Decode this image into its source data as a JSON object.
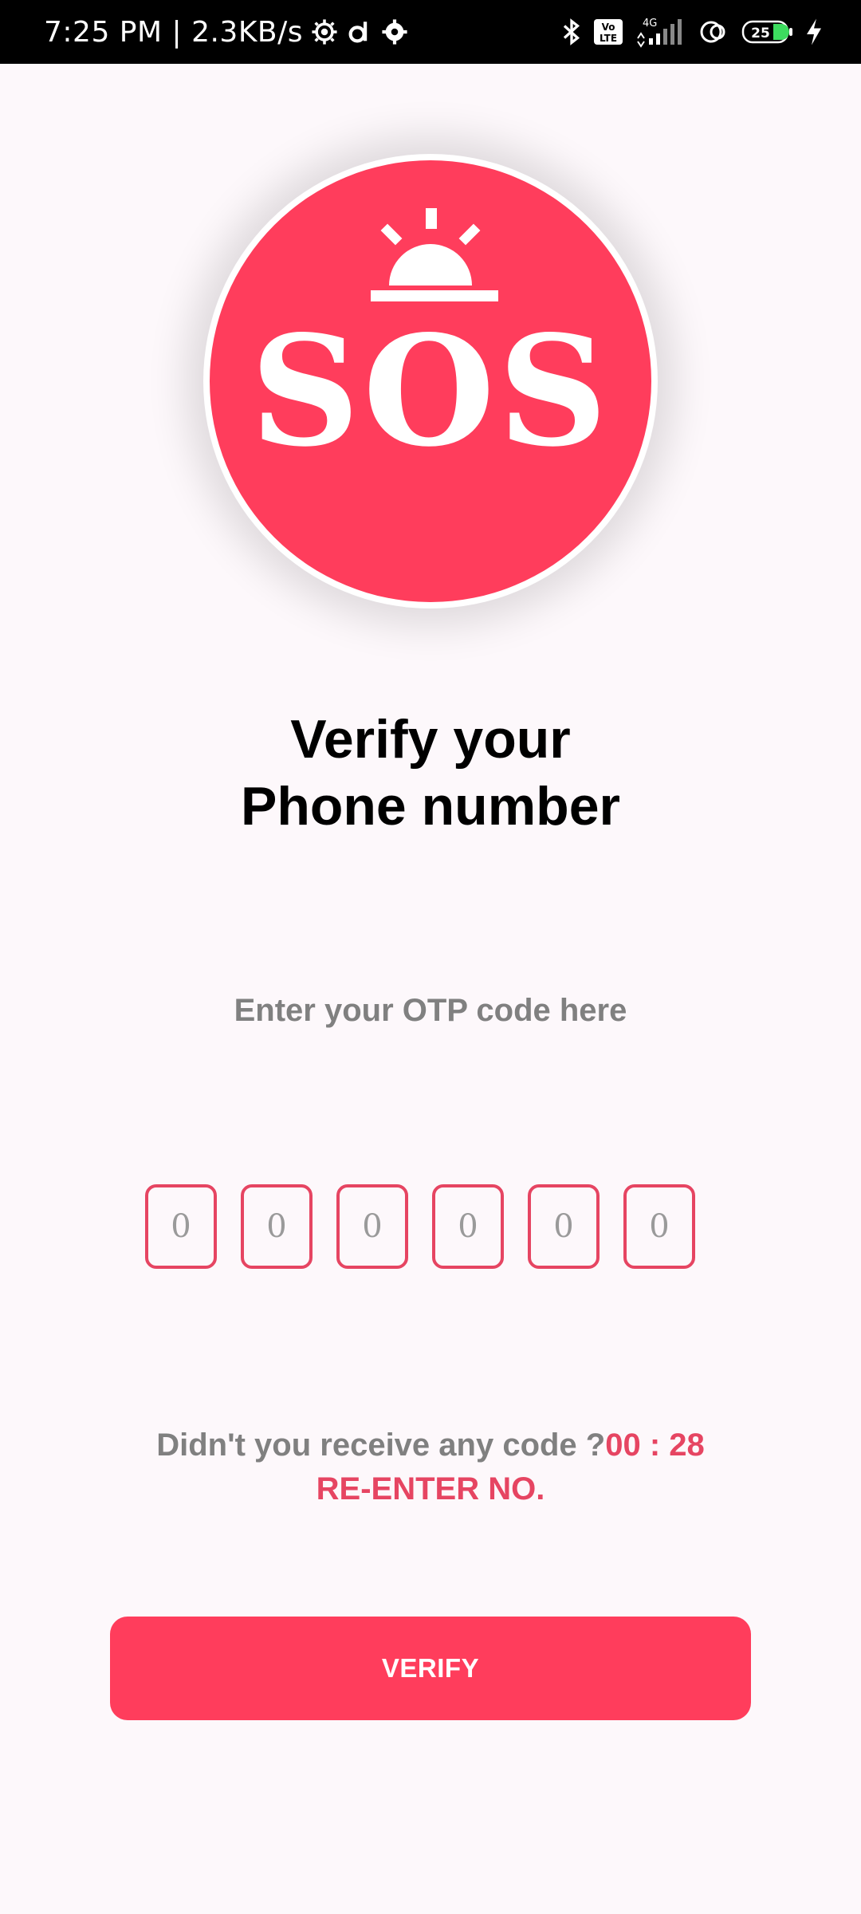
{
  "status_bar": {
    "time_speed": "7:25 PM | 2.3KB/s",
    "network_label": "4G",
    "volte_label": "Vo LTE",
    "battery_level": "25",
    "icons": [
      "gear-icon",
      "d-app-icon",
      "settings-icon",
      "bluetooth-icon",
      "volte-icon",
      "signal-icon",
      "hotspot-icon",
      "battery-icon",
      "charging-icon"
    ]
  },
  "logo": {
    "text": "SOS",
    "bg_color": "#ff3d5c"
  },
  "title": {
    "line1": "Verify your",
    "line2": "Phone number"
  },
  "subtitle": "Enter your OTP code here",
  "otp": {
    "placeholders": [
      "0",
      "0",
      "0",
      "0",
      "0",
      "0"
    ],
    "border_color": "#e64562"
  },
  "resend": {
    "question": "Didn't you receive any code ?",
    "timer": "00 : 28",
    "reenter_label": "RE-ENTER NO."
  },
  "verify_button": {
    "label": "VERIFY",
    "color": "#ff3d5c"
  }
}
